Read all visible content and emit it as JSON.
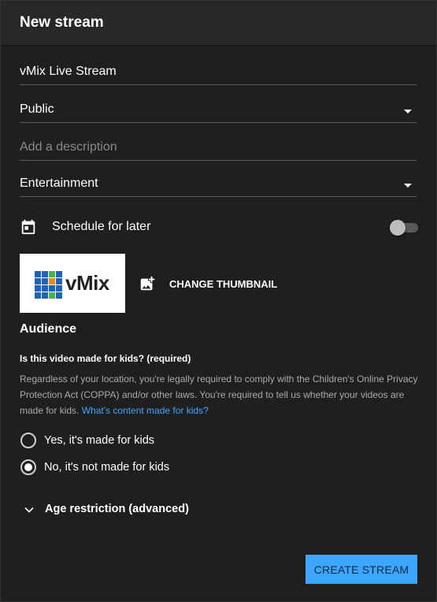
{
  "dialog": {
    "title": "New stream"
  },
  "form": {
    "title_value": "vMix Live Stream",
    "visibility_value": "Public",
    "description_placeholder": "Add a description",
    "category_value": "Entertainment"
  },
  "schedule": {
    "label": "Schedule for later",
    "enabled": false
  },
  "thumbnail": {
    "logo_text": "vMix",
    "change_label": "CHANGE THUMBNAIL",
    "grid_colors": [
      "#1e63b8",
      "#1e63b8",
      "#4caf50",
      "#1e63b8",
      "#1e63b8",
      "#1e63b8",
      "#e78a1a",
      "#1e63b8",
      "#1e63b8",
      "#1e63b8",
      "#1e63b8",
      "#1e63b8",
      "#1e63b8",
      "#1e63b8",
      "#4caf50",
      "#1e63b8"
    ]
  },
  "audience": {
    "title": "Audience",
    "question": "Is this video made for kids? (required)",
    "description": "Regardless of your location, you're legally required to comply with the Children's Online Privacy Protection Act (COPPA) and/or other laws. You're required to tell us whether your videos are made for kids.",
    "link_text": "What's content made for kids?",
    "options": [
      {
        "label": "Yes, it's made for kids",
        "selected": false
      },
      {
        "label": "No, it's not made for kids",
        "selected": true
      }
    ]
  },
  "age_restriction": {
    "label": "Age restriction (advanced)"
  },
  "actions": {
    "create_label": "CREATE STREAM"
  },
  "colors": {
    "accent": "#3ea6ff",
    "background": "#1f1f1f",
    "header": "#282828"
  },
  "icons": [
    "calendar-icon",
    "add-photo-icon",
    "chevron-down-icon",
    "dropdown-caret-icon"
  ]
}
